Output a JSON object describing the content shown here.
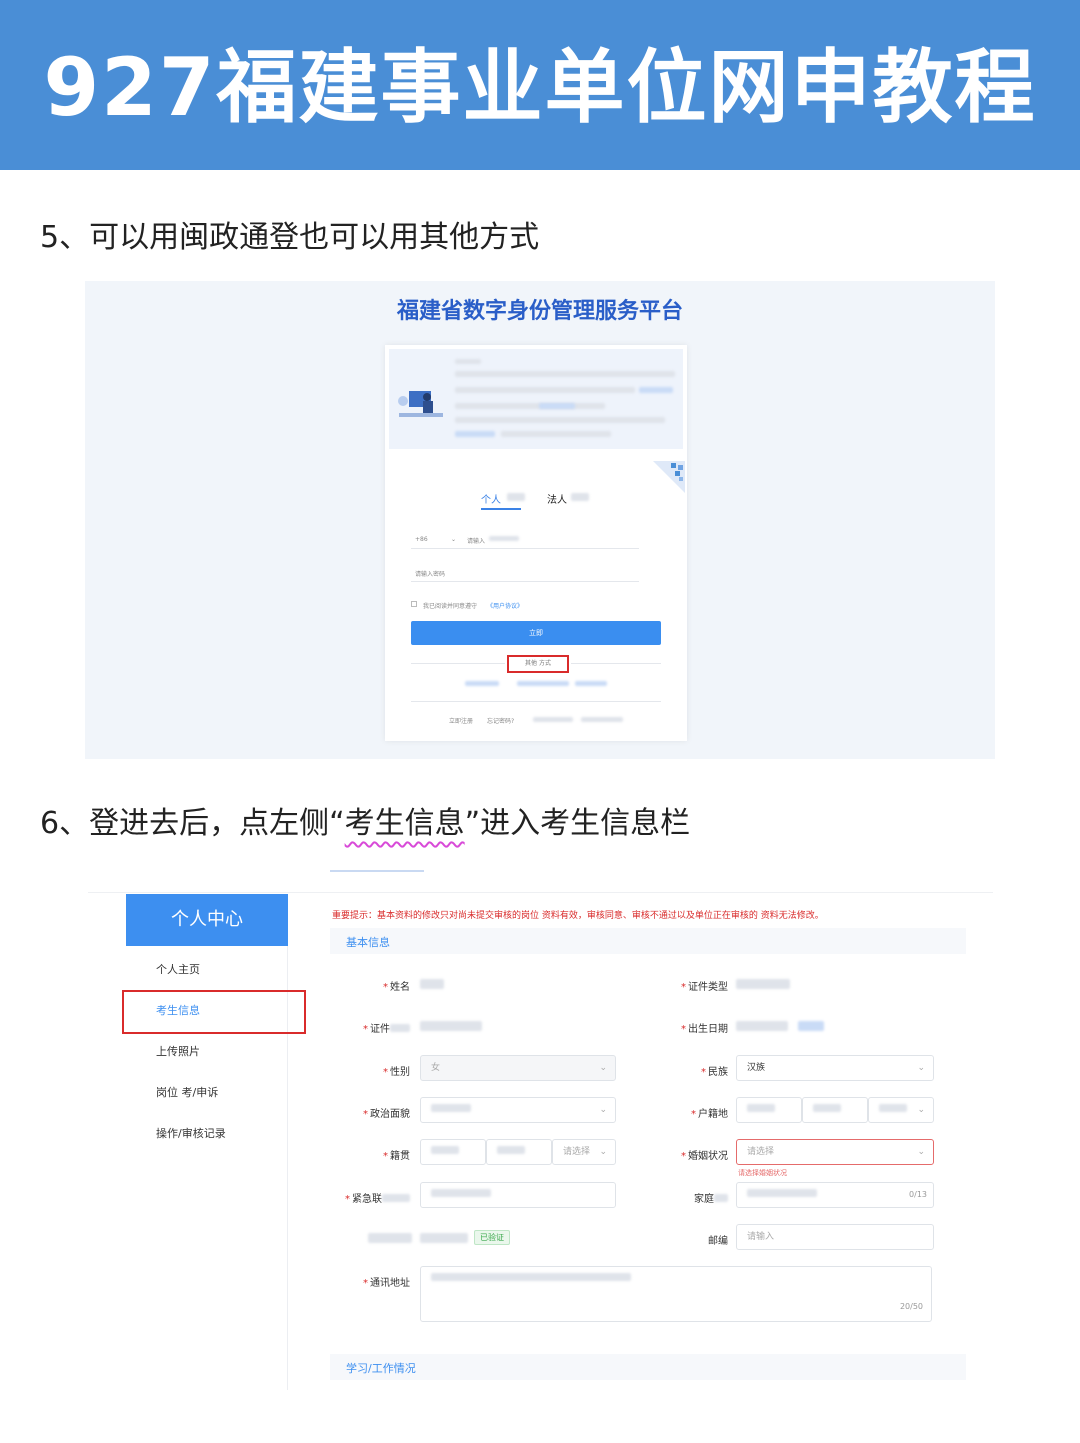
{
  "banner": {
    "title": "927福建事业单位网申教程",
    "bg_color": "#4a8ed6"
  },
  "steps": {
    "step5": {
      "text": "5、可以用闽政通登也可以用其他方式"
    },
    "step6": {
      "prefix": "6、登进去后，点左侧“",
      "highlight": "考生信息",
      "suffix": "”进入考生信息栏"
    }
  },
  "login": {
    "platform_title": "福建省数字身份管理服务平台",
    "tabs": {
      "person": "个人",
      "legal": "法人"
    },
    "phone_prefix": "+86",
    "phone_placeholder": "请输入",
    "password_placeholder": "请输入密码",
    "agree_text": "我已阅读并同意遵守",
    "agree_link": "《用户协议》",
    "login_button": "立即",
    "other_methods": "其他 方式",
    "footer": {
      "register": "立即注册",
      "forgot": "忘记密码?"
    },
    "accent_color": "#3a8ef0"
  },
  "profile": {
    "sidebar": {
      "header": "个人中心",
      "items": [
        "个人主页",
        "考生信息",
        "上传照片",
        "岗位 考/申诉",
        "操作/审核记录"
      ],
      "active_index": 1
    },
    "notice": "重要提示：基本资料的修改只对尚未提交审核的岗位 资料有效，审核同意、审核不通过以及单位正在审核的 资料无法修改。",
    "section_basic": "基本信息",
    "section_study": "学习/工作情况",
    "fields": {
      "name_label": "姓名",
      "id_type_label": "证件类型",
      "id_label": "证件",
      "birth_label": "出生日期",
      "gender_label": "性别",
      "gender_value": "女",
      "ethnic_label": "民族",
      "ethnic_value": "汉族",
      "political_label": "政治面貌",
      "hukou_label": "户籍地",
      "origin_label": "籍贯",
      "origin_placeholder": "请选择",
      "marital_label": "婚姻状况",
      "marital_placeholder": "请选择",
      "marital_error": "请选择婚姻状况",
      "emergency_label": "紧急联",
      "home_label": "家庭",
      "home_counter": "0/13",
      "verified_badge": "已验证",
      "postcode_label": "邮编",
      "postcode_placeholder": "请输入",
      "address_label": "通讯地址",
      "address_counter": "20/50"
    },
    "accent_color": "#3d8ff0",
    "highlight_color": "#d92b2b"
  }
}
